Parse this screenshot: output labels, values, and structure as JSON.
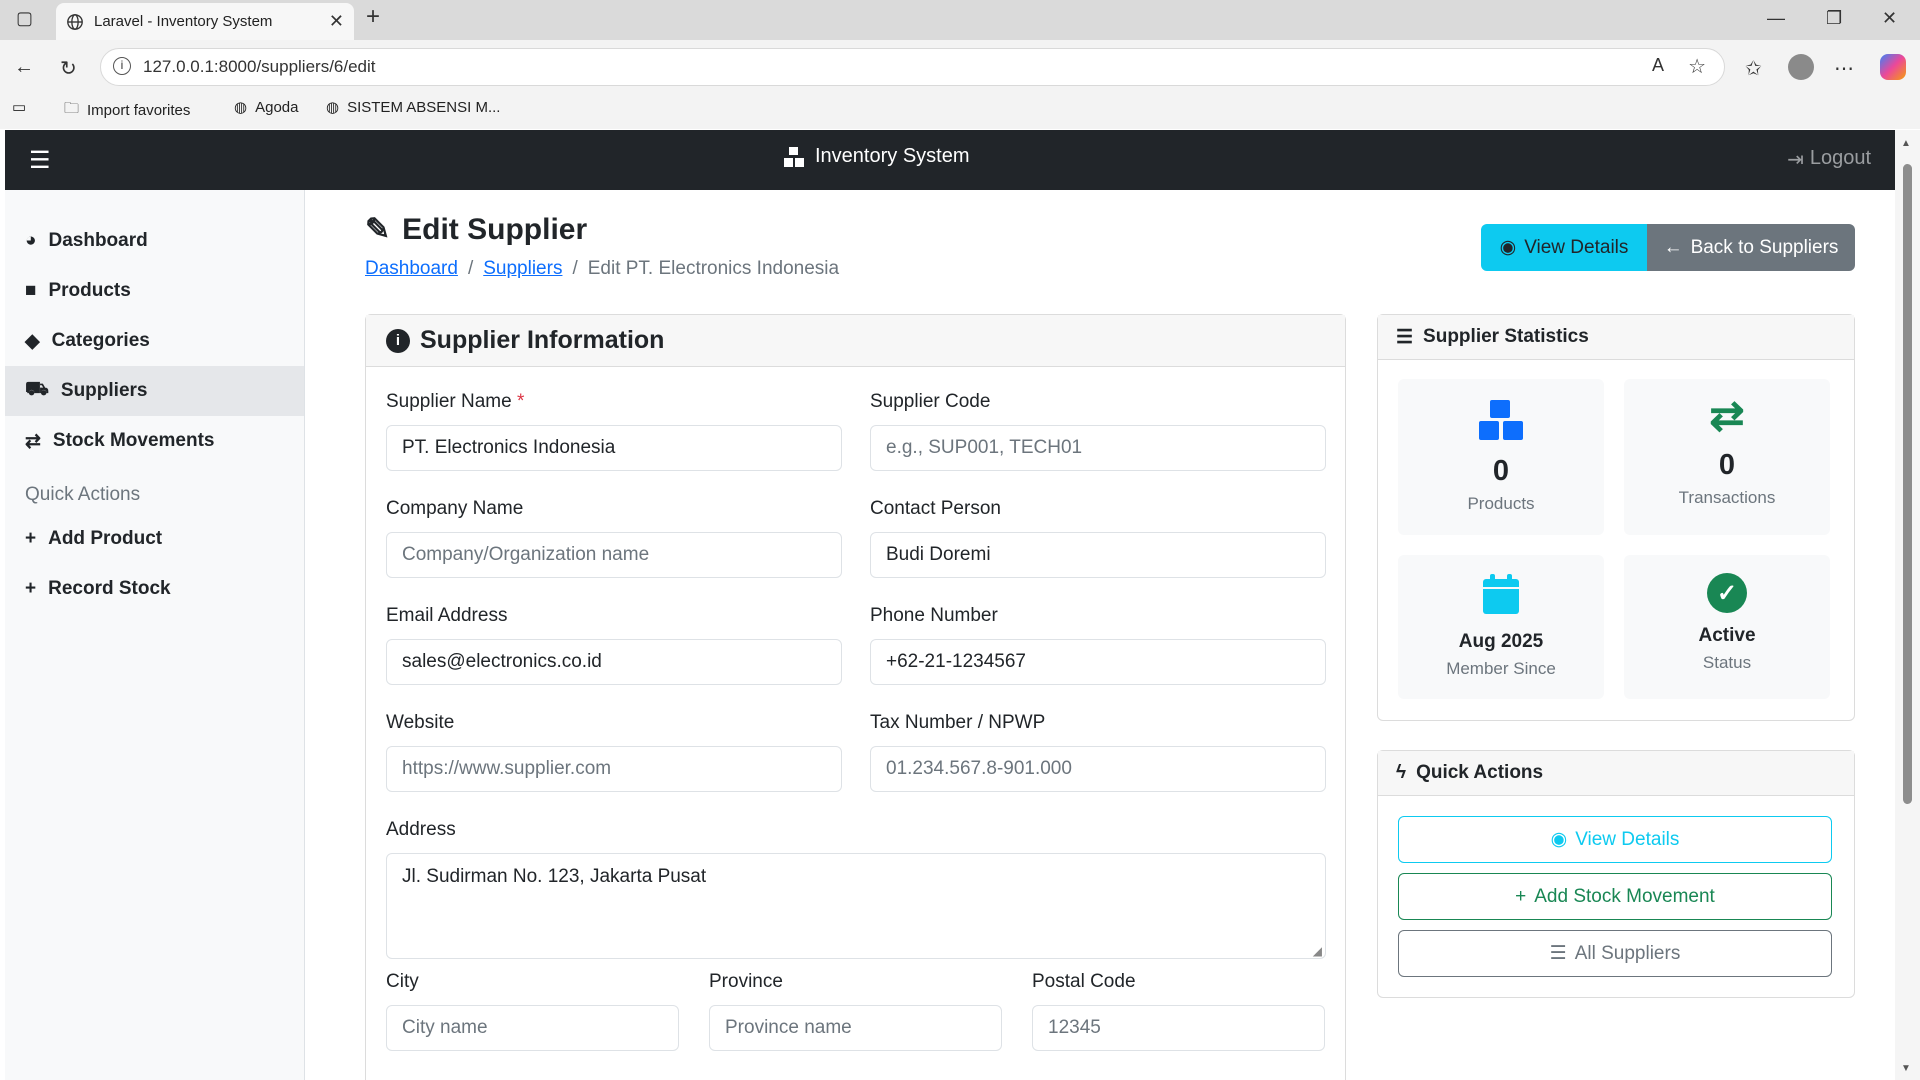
{
  "browser": {
    "tab_title": "Laravel - Inventory System",
    "url": "127.0.0.1:8000/suppliers/6/edit",
    "bookmarks": [
      "Import favorites",
      "Agoda",
      "SISTEM ABSENSI M..."
    ]
  },
  "navbar": {
    "brand": "Inventory System",
    "logout": "Logout"
  },
  "sidebar": {
    "items": [
      {
        "label": "Dashboard"
      },
      {
        "label": "Products"
      },
      {
        "label": "Categories"
      },
      {
        "label": "Suppliers"
      },
      {
        "label": "Stock Movements"
      }
    ],
    "quick_actions_heading": "Quick Actions",
    "quick": [
      {
        "label": "Add Product"
      },
      {
        "label": "Record Stock"
      }
    ]
  },
  "page": {
    "title": "Edit Supplier",
    "breadcrumb": [
      "Dashboard",
      "Suppliers",
      "Edit PT. Electronics Indonesia"
    ],
    "btn_view": "View Details",
    "btn_back": "Back to Suppliers"
  },
  "form": {
    "title": "Supplier Information",
    "supplier_name": {
      "label": "Supplier Name",
      "required": "*",
      "value": "PT. Electronics Indonesia"
    },
    "supplier_code": {
      "label": "Supplier Code",
      "placeholder": "e.g., SUP001, TECH01"
    },
    "company_name": {
      "label": "Company Name",
      "placeholder": "Company/Organization name"
    },
    "contact_person": {
      "label": "Contact Person",
      "value": "Budi Doremi"
    },
    "email": {
      "label": "Email Address",
      "value": "sales@electronics.co.id"
    },
    "phone": {
      "label": "Phone Number",
      "value": "+62-21-1234567"
    },
    "website": {
      "label": "Website",
      "placeholder": "https://www.supplier.com"
    },
    "tax": {
      "label": "Tax Number / NPWP",
      "placeholder": "01.234.567.8-901.000"
    },
    "address": {
      "label": "Address",
      "value": "Jl. Sudirman No. 123, Jakarta Pusat"
    },
    "city": {
      "label": "City",
      "placeholder": "City name"
    },
    "province": {
      "label": "Province",
      "placeholder": "Province name"
    },
    "postal": {
      "label": "Postal Code",
      "placeholder": "12345"
    }
  },
  "stats": {
    "title": "Supplier Statistics",
    "products": {
      "value": "0",
      "label": "Products"
    },
    "transactions": {
      "value": "0",
      "label": "Transactions"
    },
    "member": {
      "value": "Aug 2025",
      "label": "Member Since"
    },
    "status": {
      "value": "Active",
      "label": "Status"
    }
  },
  "quick_actions": {
    "title": "Quick Actions",
    "view": "View Details",
    "add": "Add Stock Movement",
    "all": "All Suppliers"
  },
  "colors": {
    "primary": "#0d6efd",
    "info": "#0dcaf0",
    "success": "#198754",
    "secondary": "#6c757d",
    "dark": "#212529"
  }
}
